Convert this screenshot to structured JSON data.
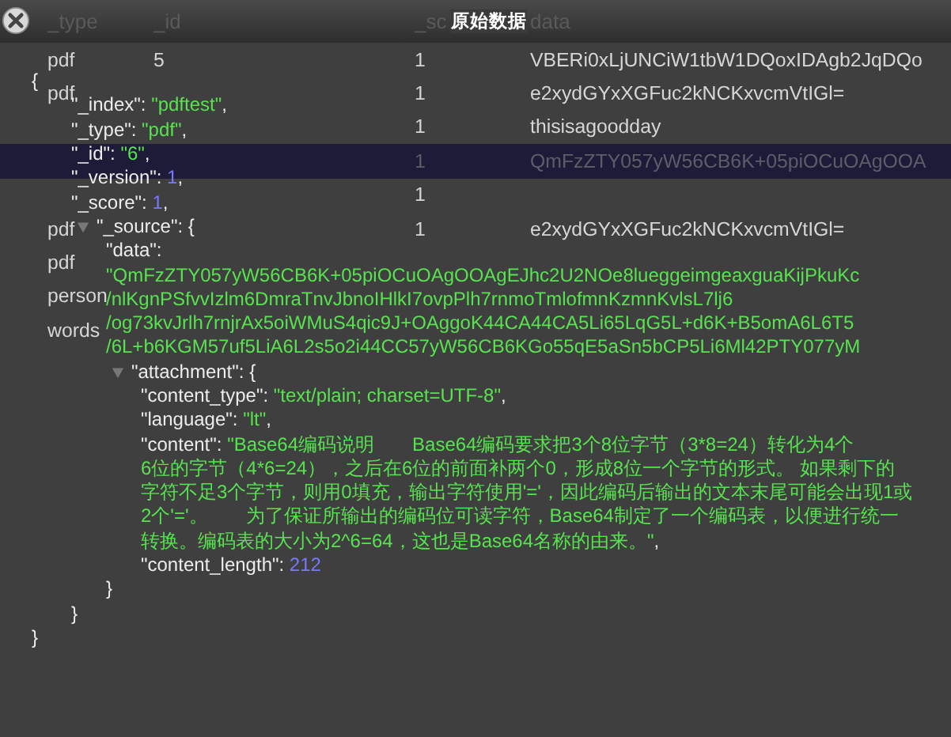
{
  "dialog": {
    "title": "原始数据"
  },
  "table": {
    "columns": [
      "_type",
      "_id",
      "_sc",
      "data"
    ],
    "rows": [
      {
        "type": "pdf",
        "id": "5",
        "score": "1",
        "data": "VBERi0xLjUNCiW1tbW1DQoxIDAgb2JqDQo",
        "selected": false
      },
      {
        "type": "pdf",
        "score": "1",
        "data": "e2xydGYxXGFuc2kNCKxvcmVtIGl=",
        "selected": false
      },
      {
        "score": "1",
        "data": "thisisagoodday",
        "selected": false
      },
      {
        "score": "1",
        "data": "QmFzZTY057yW56CB6K+05piOCuOAgOOA",
        "selected": true
      },
      {
        "score": "1",
        "selected": false
      },
      {
        "type": "pdf",
        "score": "1",
        "data": "e2xydGYxXGFuc2kNCKxvcmVtIGl=",
        "selected": false
      },
      {
        "type": "pdf",
        "selected": false
      },
      {
        "type": "person",
        "selected": false
      },
      {
        "type": "words",
        "selected": false
      }
    ]
  },
  "viewer": {
    "open": "{",
    "close": "}",
    "children": [
      {
        "key": "\"_index\": ",
        "kind": "string",
        "value": [
          "\"pdftest\""
        ],
        "end": ","
      },
      {
        "key": "\"_type\": ",
        "kind": "string",
        "value": [
          "\"pdf\""
        ],
        "end": ","
      },
      {
        "key": "\"_id\": ",
        "kind": "string",
        "value": [
          "\"6\""
        ],
        "end": ","
      },
      {
        "key": "\"_version\": ",
        "kind": "number",
        "value": [
          "1"
        ],
        "end": ","
      },
      {
        "key": "\"_score\": ",
        "kind": "number",
        "value": [
          "1"
        ],
        "end": ","
      },
      {
        "key": "\"_source\": ",
        "kind": "object",
        "expanded": true,
        "open": "{",
        "close": "}",
        "children": [
          {
            "key": "\"data\":",
            "kind": "text_block",
            "value": [
              "\"QmFzZTY057yW56CB6K+05piOCuOAgOOAgEJhc2U2NOe8lueggeimgeaxguaKijPkuKc",
              "/nlKgnPSfvvIzlm6DmraTnvJbnoIHlkI7ovpPlh7rnmoTmlofmnKzmnKvlsL7lj6",
              "/og73kvJrlh7rnjrAx5oiWMuS4qic9J+OAggoK44CA44CA5Li65LqG5L+d6K+B5omA6L6T5",
              "/6L+b6KGM57uf5LiA6L2s5o2i44CC57yW56CB6KGo55qE5aSn5bCP5Li6Ml42PTY077yM"
            ]
          },
          {
            "key": "\"attachment\": ",
            "kind": "object",
            "expanded": true,
            "open": "{",
            "close": "}",
            "children": [
              {
                "key": "\"content_type\": ",
                "kind": "string",
                "value": [
                  "\"text/plain; charset=UTF-8\""
                ],
                "end": ","
              },
              {
                "key": "\"language\": ",
                "kind": "string",
                "value": [
                  "\"lt\""
                ],
                "end": ","
              },
              {
                "key": "\"content\": ",
                "kind": "string",
                "value": [
                  "\"Base64编码说明　　Base64编码要求把3个8位字节（3*8=24）转化为4个",
                  "6位的字节（4*6=24），之后在6位的前面补两个0，形成8位一个字节的形式。 如果剩下的",
                  "字符不足3个字节，则用0填充，输出字符使用'='，因此编码后输出的文本末尾可能会出现1或",
                  "2个'='。　　为了保证所输出的编码位可读字符，Base64制定了一个编码表，以便进行统一",
                  "转换。编码表的大小为2^6=64，这也是Base64名称的由来。\""
                ],
                "end": ","
              },
              {
                "key": "\"content_length\": ",
                "kind": "number",
                "value": [
                  "212"
                ]
              }
            ]
          }
        ]
      }
    ]
  }
}
